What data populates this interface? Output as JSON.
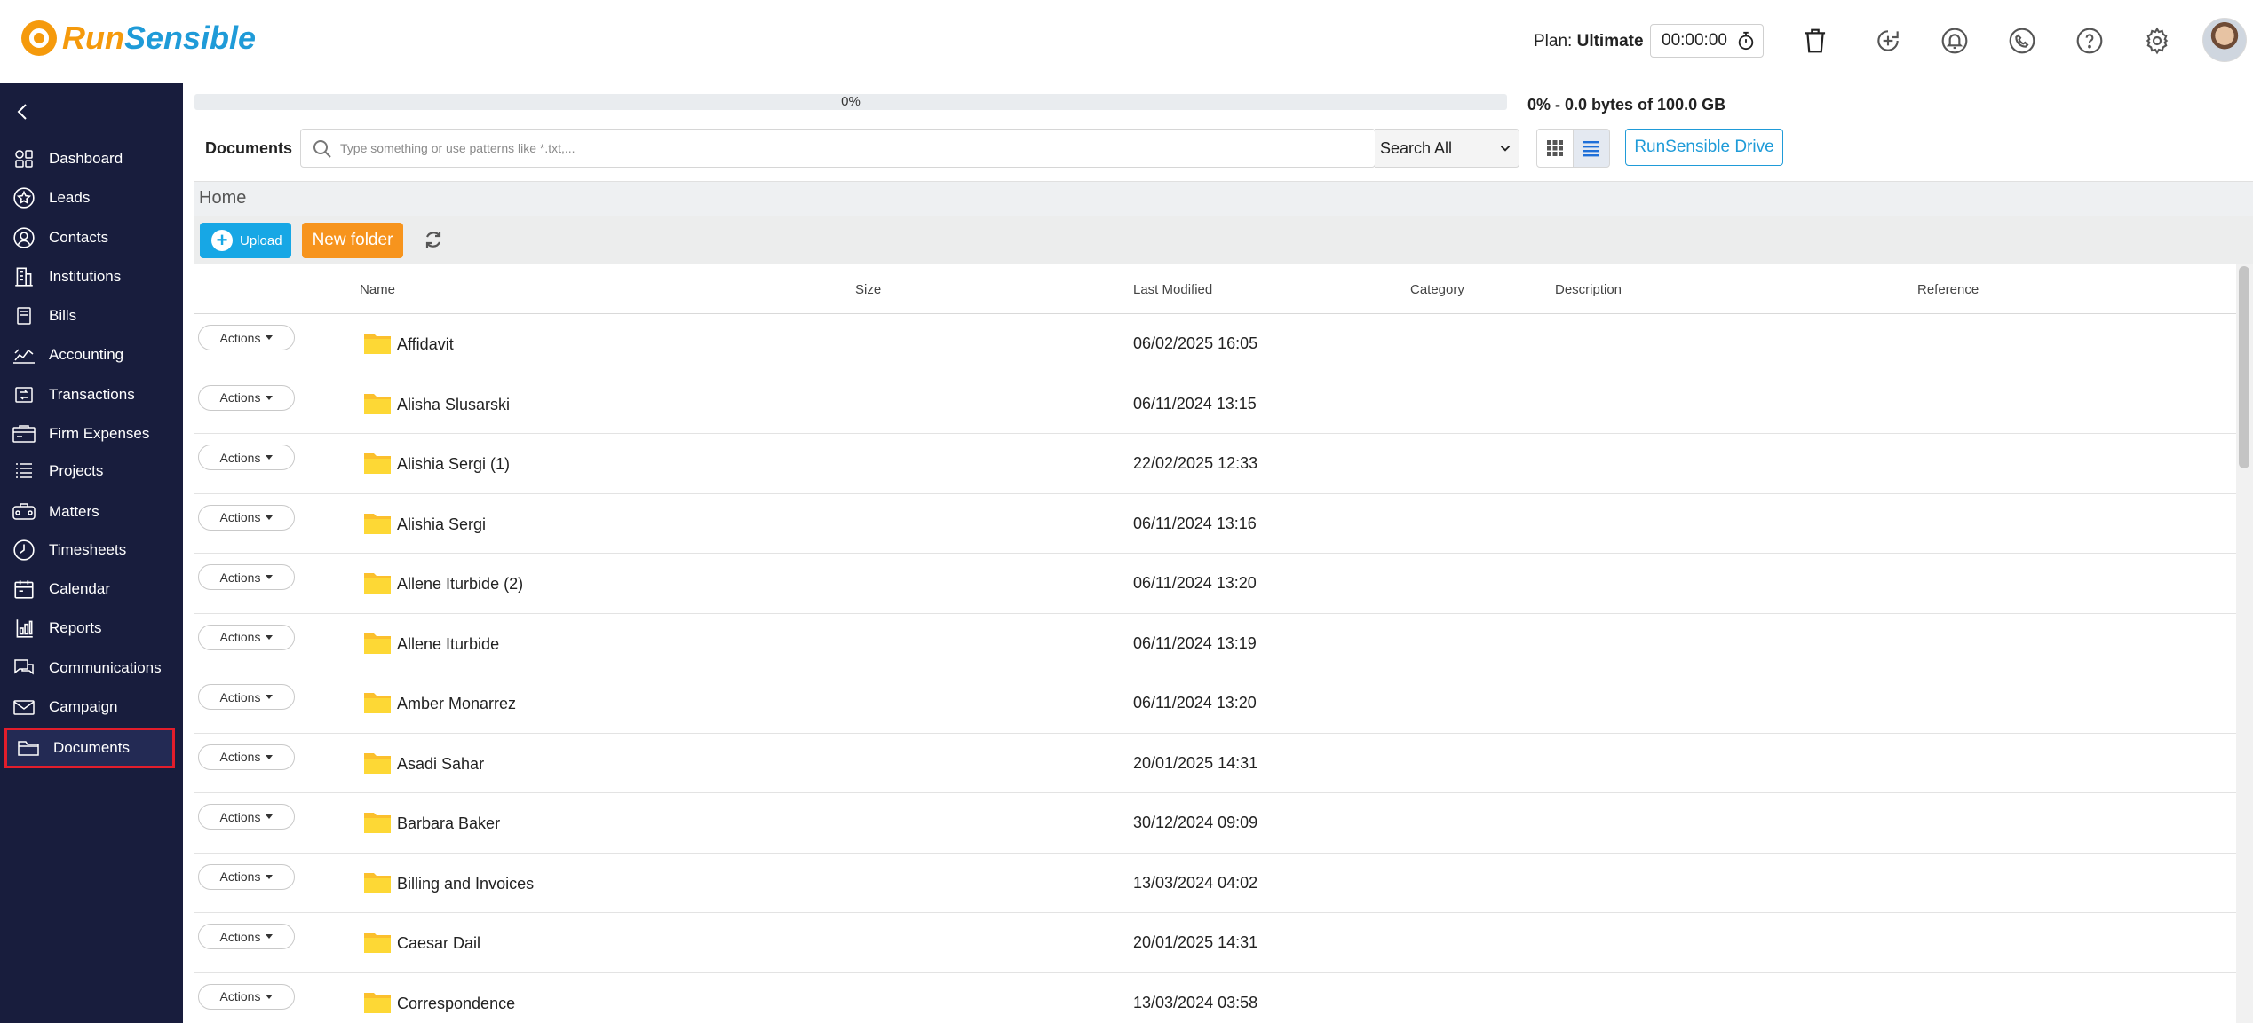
{
  "app": {
    "brand_part1": "Run",
    "brand_part2": "Sensible"
  },
  "header": {
    "plan_label": "Plan:",
    "plan_value": "Ultimate",
    "timer": "00:00:00",
    "icons": [
      "trash-icon",
      "add-time-icon",
      "bell-icon",
      "phone-icon",
      "help-icon",
      "gear-icon"
    ]
  },
  "sidebar": {
    "items": [
      {
        "label": "Dashboard",
        "icon": "dashboard-icon"
      },
      {
        "label": "Leads",
        "icon": "star-icon"
      },
      {
        "label": "Contacts",
        "icon": "contact-icon"
      },
      {
        "label": "Institutions",
        "icon": "building-icon"
      },
      {
        "label": "Bills",
        "icon": "bill-icon"
      },
      {
        "label": "Accounting",
        "icon": "accounting-icon"
      },
      {
        "label": "Transactions",
        "icon": "transactions-icon"
      },
      {
        "label": "Firm Expenses",
        "icon": "expenses-icon"
      },
      {
        "label": "Projects",
        "icon": "projects-icon"
      },
      {
        "label": "Matters",
        "icon": "matters-icon"
      },
      {
        "label": "Timesheets",
        "icon": "clock-icon"
      },
      {
        "label": "Calendar",
        "icon": "calendar-icon"
      },
      {
        "label": "Reports",
        "icon": "reports-icon"
      },
      {
        "label": "Communications",
        "icon": "chat-icon"
      },
      {
        "label": "Campaign",
        "icon": "envelope-icon"
      },
      {
        "label": "Documents",
        "icon": "folder-icon"
      }
    ],
    "active": "Documents"
  },
  "storage": {
    "progress_label": "0%",
    "progress_fraction": 0,
    "usage_text": "0% - 0.0 bytes of 100.0 GB"
  },
  "toolbar": {
    "section_label": "Documents",
    "search_placeholder": "Type something or use patterns like *.txt,...",
    "search_scope": "Search All",
    "drive_button": "RunSensible Drive",
    "breadcrumb": "Home",
    "upload_label": "Upload",
    "new_folder_label": "New folder"
  },
  "table": {
    "columns": [
      "Name",
      "Size",
      "Last Modified",
      "Category",
      "Description",
      "Reference"
    ],
    "actions_label": "Actions",
    "rows": [
      {
        "name": "Affidavit",
        "modified": "06/02/2025 16:05"
      },
      {
        "name": "Alisha Slusarski",
        "modified": "06/11/2024 13:15"
      },
      {
        "name": "Alishia Sergi (1)",
        "modified": "22/02/2025 12:33"
      },
      {
        "name": "Alishia Sergi",
        "modified": "06/11/2024 13:16"
      },
      {
        "name": "Allene Iturbide (2)",
        "modified": "06/11/2024 13:20"
      },
      {
        "name": "Allene Iturbide",
        "modified": "06/11/2024 13:19"
      },
      {
        "name": "Amber Monarrez",
        "modified": "06/11/2024 13:20"
      },
      {
        "name": "Asadi Sahar",
        "modified": "20/01/2025 14:31"
      },
      {
        "name": "Barbara Baker",
        "modified": "30/12/2024 09:09"
      },
      {
        "name": "Billing and Invoices",
        "modified": "13/03/2024 04:02"
      },
      {
        "name": "Caesar Dail",
        "modified": "20/01/2025 14:31"
      },
      {
        "name": "Correspondence",
        "modified": "13/03/2024 03:58"
      }
    ]
  },
  "colors": {
    "sidebar_bg": "#181d3d",
    "brand_orange": "#f59a0c",
    "brand_blue": "#1f9bd8",
    "upload_blue": "#17a7e5",
    "new_folder_orange": "#f7941d",
    "folder_yellow": "#fbc02d",
    "active_outline": "#e21d2b"
  }
}
